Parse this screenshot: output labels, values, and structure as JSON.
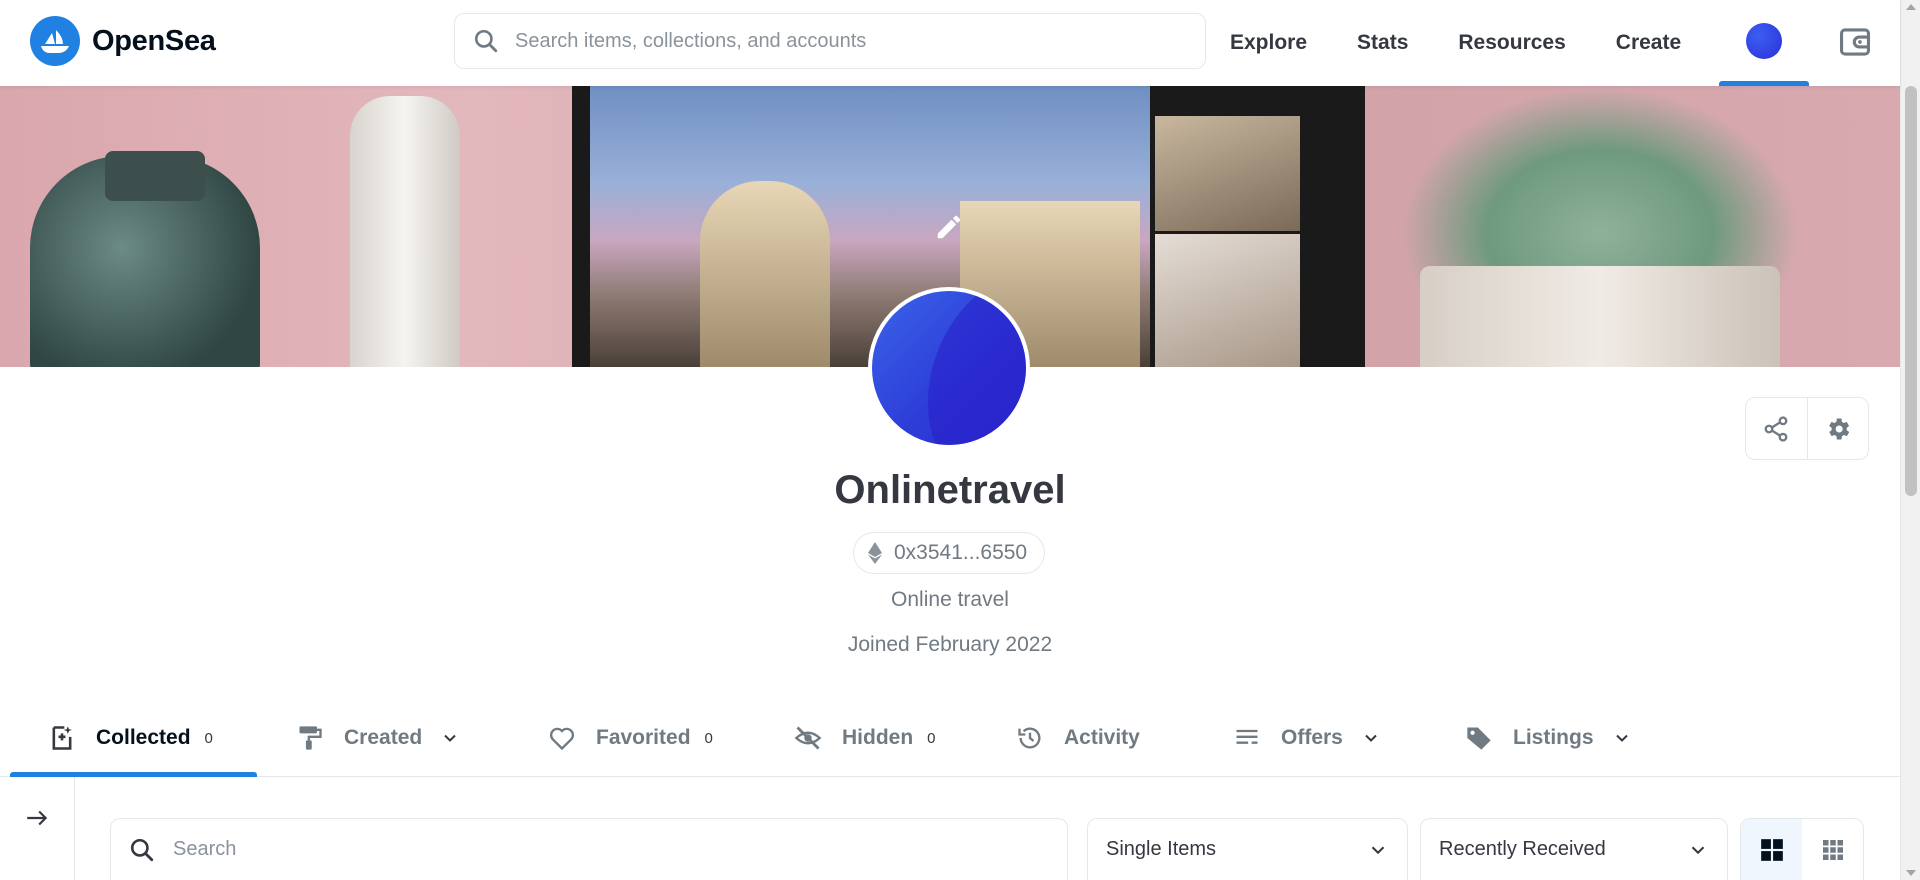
{
  "header": {
    "brand": "OpenSea",
    "search_placeholder": "Search items, collections, and accounts",
    "nav": [
      "Explore",
      "Stats",
      "Resources",
      "Create"
    ],
    "accent_color": "#2081e2"
  },
  "profile": {
    "name": "Onlinetravel",
    "address": "0x3541...6550",
    "bio": "Online travel",
    "joined": "Joined February 2022"
  },
  "tabs": [
    {
      "label": "Collected",
      "count": "0",
      "icon": "collected-icon",
      "active": true
    },
    {
      "label": "Created",
      "icon": "paint-roller-icon",
      "dropdown": true
    },
    {
      "label": "Favorited",
      "count": "0",
      "icon": "heart-icon"
    },
    {
      "label": "Hidden",
      "count": "0",
      "icon": "eye-off-icon"
    },
    {
      "label": "Activity",
      "icon": "history-icon"
    },
    {
      "label": "Offers",
      "icon": "list-icon",
      "dropdown": true
    },
    {
      "label": "Listings",
      "icon": "tag-icon",
      "dropdown": true
    }
  ],
  "filters": {
    "search_placeholder": "Search",
    "item_type": "Single Items",
    "sort": "Recently Received"
  }
}
